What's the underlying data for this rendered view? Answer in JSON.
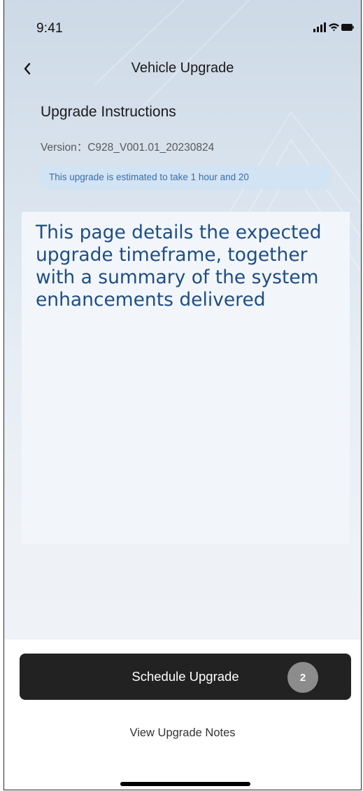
{
  "status_bar": {
    "time": "9:41"
  },
  "nav": {
    "title": "Vehicle Upgrade"
  },
  "instructions": {
    "title": "Upgrade Instructions",
    "version": "Version：C928_V001.01_20230824",
    "estimate": "This upgrade is estimated to take 1 hour and 20"
  },
  "overlay": {
    "text": "This page details the expected upgrade timeframe, together with a summary of the system enhancements delivered"
  },
  "actions": {
    "primary_label": "Schedule Upgrade",
    "step_badge": "2",
    "secondary_label": "View Upgrade Notes"
  },
  "colors": {
    "accent_text": "#1f4e85",
    "estimate_bg": "#d2e3f3",
    "primary_button": "#222222"
  }
}
